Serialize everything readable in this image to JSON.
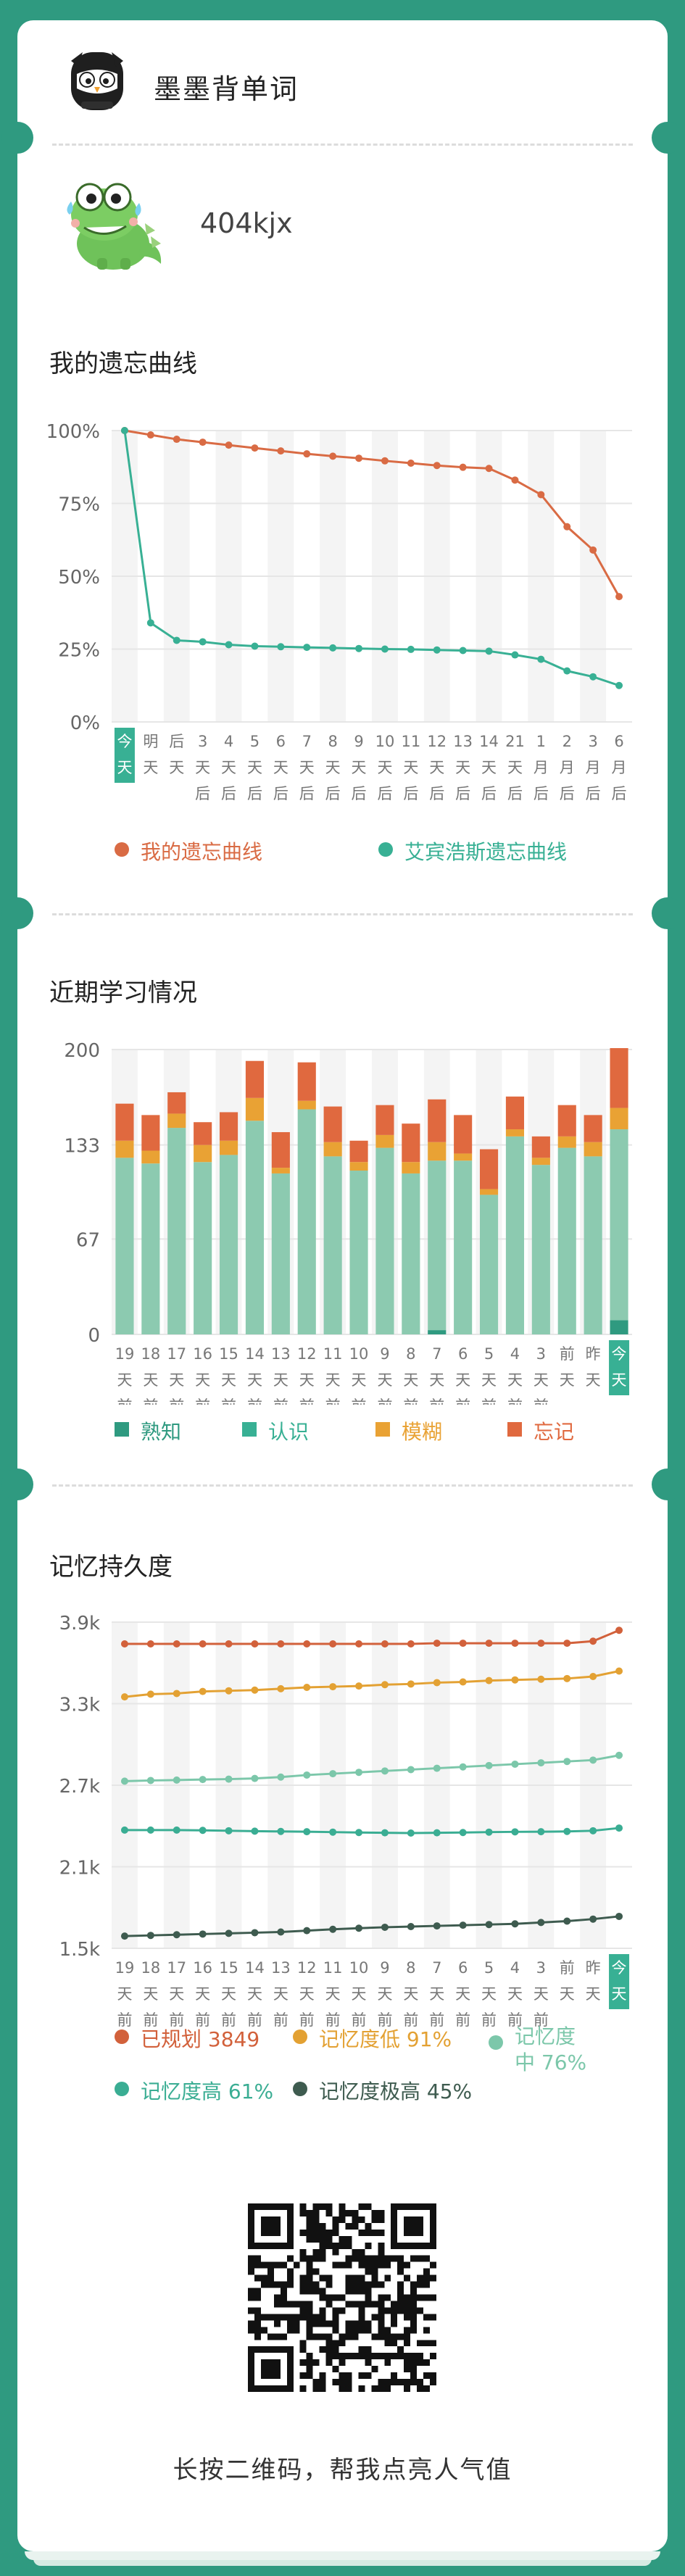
{
  "app": {
    "title": "墨墨背单词"
  },
  "user": {
    "name": "404kjx"
  },
  "colors": {
    "brand": "#2f9a80",
    "mine": "#d96b44",
    "ebbinghaus": "#38b094",
    "familiar": "#8ccab0",
    "recognize": "#38b094",
    "fuzzy": "#e9a234",
    "forget": "#e0693f",
    "planned": "#d2613b",
    "low": "#e3a133",
    "mid": "#7cc7aa",
    "high": "#3aad93",
    "very_high": "#3e5b4f",
    "today_badge": "#38b094"
  },
  "forgetting": {
    "title": "我的遗忘曲线",
    "legend": [
      {
        "label": "我的遗忘曲线",
        "color": "#d96b44"
      },
      {
        "label": "艾宾浩斯遗忘曲线",
        "color": "#38b094"
      }
    ]
  },
  "study": {
    "title": "近期学习情况",
    "legend": [
      {
        "label": "熟知",
        "color": "#2f9a80"
      },
      {
        "label": "认识",
        "color": "#38b094"
      },
      {
        "label": "模糊",
        "color": "#e9a234"
      },
      {
        "label": "忘记",
        "color": "#e0693f"
      }
    ]
  },
  "retention": {
    "title": "记忆持久度",
    "legend": [
      {
        "label": "已规划 3849",
        "color": "#d2613b"
      },
      {
        "label": "记忆度低 91%",
        "color": "#e3a133"
      },
      {
        "label": "记忆度中 76%",
        "color": "#7cc7aa"
      },
      {
        "label": "记忆度高 61%",
        "color": "#3aad93"
      },
      {
        "label": "记忆度极高 45%",
        "color": "#3e5b4f"
      }
    ]
  },
  "footer": {
    "text": "长按二维码，帮我点亮人气值"
  },
  "chart_data": [
    {
      "type": "line",
      "title": "我的遗忘曲线",
      "categories": [
        [
          "今",
          "天"
        ],
        [
          "明",
          "天"
        ],
        [
          "后",
          "天"
        ],
        [
          "3",
          "天",
          "后"
        ],
        [
          "4",
          "天",
          "后"
        ],
        [
          "5",
          "天",
          "后"
        ],
        [
          "6",
          "天",
          "后"
        ],
        [
          "7",
          "天",
          "后"
        ],
        [
          "8",
          "天",
          "后"
        ],
        [
          "9",
          "天",
          "后"
        ],
        [
          "10",
          "天",
          "后"
        ],
        [
          "11",
          "天",
          "后"
        ],
        [
          "12",
          "天",
          "后"
        ],
        [
          "13",
          "天",
          "后"
        ],
        [
          "14",
          "天",
          "后"
        ],
        [
          "21",
          "天",
          "后"
        ],
        [
          "1",
          "月",
          "后"
        ],
        [
          "2",
          "月",
          "后"
        ],
        [
          "3",
          "月",
          "后"
        ],
        [
          "6",
          "月",
          "后"
        ]
      ],
      "ylim": [
        0,
        100
      ],
      "yticks": [
        "0%",
        "25%",
        "50%",
        "75%",
        "100%"
      ],
      "ytick_values": [
        0,
        25,
        50,
        75,
        100
      ],
      "series": [
        {
          "name": "我的遗忘曲线",
          "color": "#d96b44",
          "values": [
            100,
            98.5,
            97,
            96,
            95,
            94,
            93,
            92,
            91.2,
            90.5,
            89.6,
            88.8,
            88,
            87.4,
            87,
            83,
            78,
            67,
            59,
            43
          ]
        },
        {
          "name": "艾宾浩斯遗忘曲线",
          "color": "#38b094",
          "values": [
            100,
            34,
            28,
            27.5,
            26.5,
            26,
            25.8,
            25.6,
            25.4,
            25.2,
            25,
            24.9,
            24.7,
            24.5,
            24.3,
            23,
            21.5,
            17.5,
            15.5,
            12.5
          ]
        }
      ]
    },
    {
      "type": "bar",
      "title": "近期学习情况",
      "stacked": true,
      "categories": [
        [
          "19",
          "天",
          "前"
        ],
        [
          "18",
          "天",
          "前"
        ],
        [
          "17",
          "天",
          "前"
        ],
        [
          "16",
          "天",
          "前"
        ],
        [
          "15",
          "天",
          "前"
        ],
        [
          "14",
          "天",
          "前"
        ],
        [
          "13",
          "天",
          "前"
        ],
        [
          "12",
          "天",
          "前"
        ],
        [
          "11",
          "天",
          "前"
        ],
        [
          "10",
          "天",
          "前"
        ],
        [
          "9",
          "天",
          "前"
        ],
        [
          "8",
          "天",
          "前"
        ],
        [
          "7",
          "天",
          "前"
        ],
        [
          "6",
          "天",
          "前"
        ],
        [
          "5",
          "天",
          "前"
        ],
        [
          "4",
          "天",
          "前"
        ],
        [
          "3",
          "天",
          "前"
        ],
        [
          "前",
          "天"
        ],
        [
          "昨",
          "天"
        ],
        [
          "今",
          "天"
        ]
      ],
      "ylim": [
        0,
        200
      ],
      "yticks": [
        "0",
        "67",
        "133",
        "200"
      ],
      "ytick_values": [
        0,
        67,
        133,
        200
      ],
      "series": [
        {
          "name": "熟知",
          "color": "#2f9a80",
          "values": [
            0,
            0,
            0,
            0,
            0,
            0,
            0,
            0,
            0,
            0,
            0,
            0,
            3,
            0,
            0,
            0,
            0,
            0,
            0,
            10
          ]
        },
        {
          "name": "认识",
          "color": "#8ccab0",
          "values": [
            124,
            120,
            145,
            121,
            126,
            150,
            113,
            158,
            125,
            115,
            131,
            113,
            119,
            122,
            98,
            139,
            119,
            131,
            125,
            134
          ]
        },
        {
          "name": "模糊",
          "color": "#e9a234",
          "values": [
            12,
            9,
            10,
            12,
            10,
            16,
            4,
            6,
            10,
            6,
            9,
            8,
            13,
            5,
            4,
            5,
            5,
            8,
            10,
            15
          ]
        },
        {
          "name": "忘记",
          "color": "#e0693f",
          "values": [
            26,
            25,
            15,
            16,
            20,
            26,
            25,
            27,
            25,
            15,
            21,
            27,
            30,
            27,
            28,
            23,
            15,
            22,
            19,
            42
          ]
        }
      ]
    },
    {
      "type": "line",
      "title": "记忆持久度",
      "categories": [
        [
          "19",
          "天",
          "前"
        ],
        [
          "18",
          "天",
          "前"
        ],
        [
          "17",
          "天",
          "前"
        ],
        [
          "16",
          "天",
          "前"
        ],
        [
          "15",
          "天",
          "前"
        ],
        [
          "14",
          "天",
          "前"
        ],
        [
          "13",
          "天",
          "前"
        ],
        [
          "12",
          "天",
          "前"
        ],
        [
          "11",
          "天",
          "前"
        ],
        [
          "10",
          "天",
          "前"
        ],
        [
          "9",
          "天",
          "前"
        ],
        [
          "8",
          "天",
          "前"
        ],
        [
          "7",
          "天",
          "前"
        ],
        [
          "6",
          "天",
          "前"
        ],
        [
          "5",
          "天",
          "前"
        ],
        [
          "4",
          "天",
          "前"
        ],
        [
          "3",
          "天",
          "前"
        ],
        [
          "前",
          "天"
        ],
        [
          "昨",
          "天"
        ],
        [
          "今",
          "天"
        ]
      ],
      "ylim": [
        1500,
        3900
      ],
      "yticks": [
        "1.5k",
        "2.1k",
        "2.7k",
        "3.3k",
        "3.9k"
      ],
      "ytick_values": [
        1500,
        2100,
        2700,
        3300,
        3900
      ],
      "series": [
        {
          "name": "已规划",
          "color": "#d2613b",
          "values": [
            3740,
            3740,
            3740,
            3740,
            3740,
            3740,
            3740,
            3740,
            3740,
            3740,
            3740,
            3740,
            3745,
            3745,
            3745,
            3745,
            3745,
            3745,
            3760,
            3840
          ]
        },
        {
          "name": "记忆度低",
          "color": "#e3a133",
          "values": [
            3350,
            3370,
            3375,
            3390,
            3395,
            3400,
            3410,
            3420,
            3425,
            3430,
            3440,
            3445,
            3455,
            3460,
            3470,
            3475,
            3480,
            3485,
            3500,
            3540
          ]
        },
        {
          "name": "记忆度中",
          "color": "#7cc7aa",
          "values": [
            2730,
            2735,
            2738,
            2742,
            2745,
            2750,
            2760,
            2775,
            2785,
            2795,
            2805,
            2815,
            2825,
            2835,
            2845,
            2855,
            2865,
            2875,
            2885,
            2920
          ]
        },
        {
          "name": "记忆度高",
          "color": "#3aad93",
          "values": [
            2370,
            2370,
            2370,
            2368,
            2365,
            2362,
            2360,
            2358,
            2355,
            2352,
            2350,
            2348,
            2350,
            2352,
            2355,
            2357,
            2358,
            2360,
            2365,
            2385
          ]
        },
        {
          "name": "记忆度极高",
          "color": "#3e5b4f",
          "values": [
            1590,
            1595,
            1600,
            1605,
            1610,
            1615,
            1620,
            1630,
            1640,
            1648,
            1655,
            1660,
            1665,
            1670,
            1675,
            1680,
            1690,
            1700,
            1715,
            1735
          ]
        }
      ]
    }
  ]
}
